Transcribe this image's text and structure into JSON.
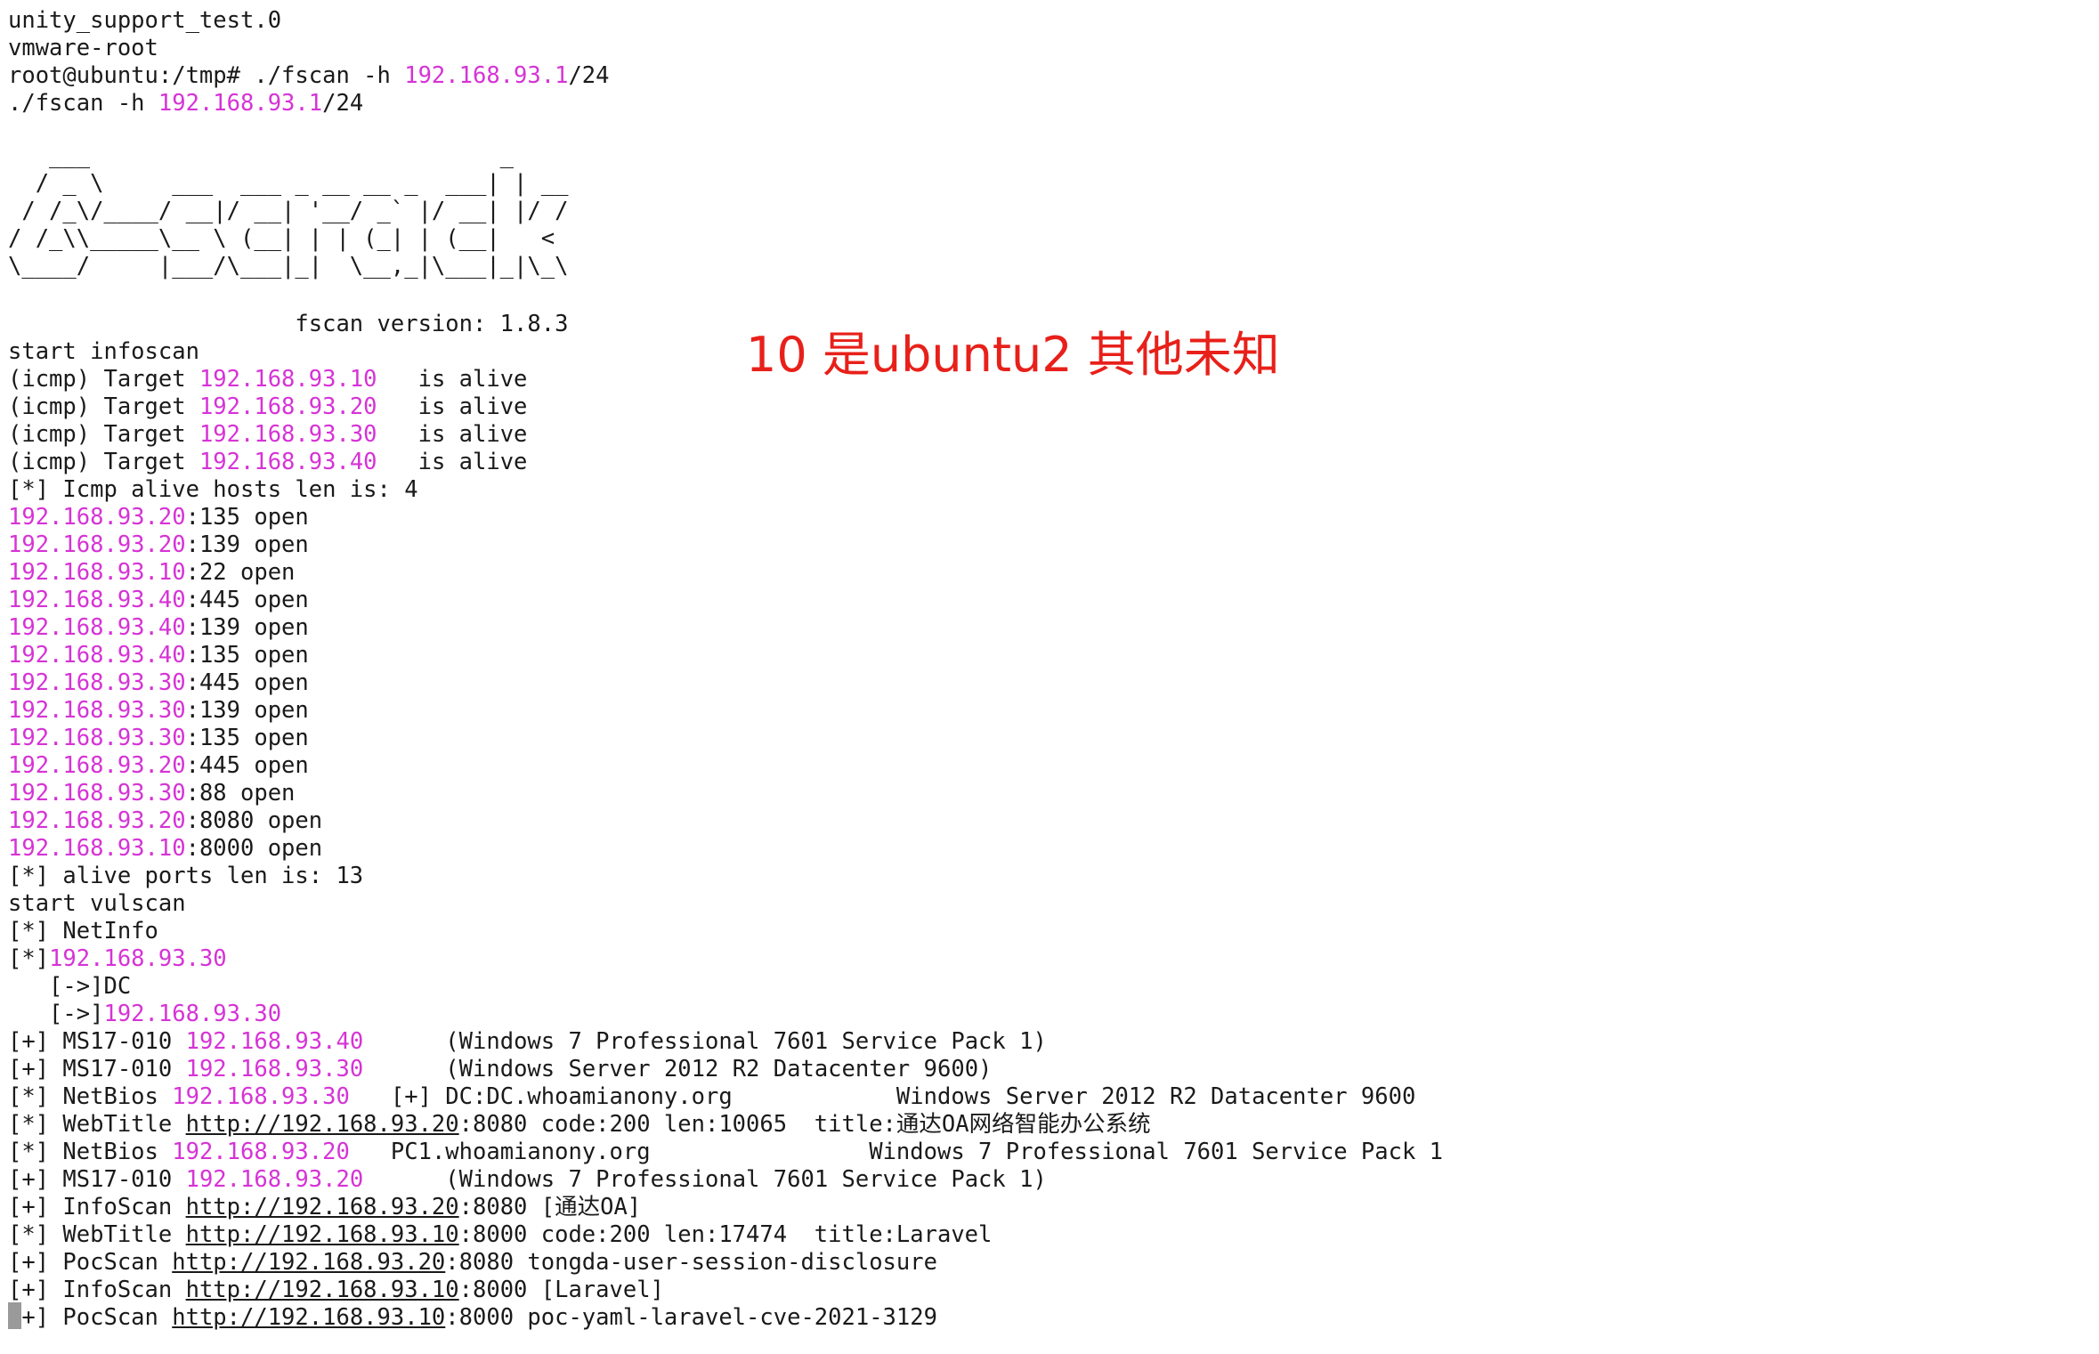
{
  "colors": {
    "background": "#ffffff",
    "text": "#1a1a1a",
    "ip": "#d633d6",
    "annotation": "#e8201a"
  },
  "banner": {
    "art": "   ___                              _    \n  / _ \\     ___  ___ _ __ __ _  ___| | __ \n / /_\\/____/ __|/ __| '__/ _` |/ __| |/ /\n/ /_\\\\_____\\__ \\ (__| | | (_| | (__|   <\n\\____/     |___/\\___|_|  \\__,_|\\___|_|\\_\\",
    "version_line": "                     fscan version: 1.8.3"
  },
  "annotation": "10 是ubuntu2 其他未知",
  "pre_lines": [
    [
      {
        "t": "unity_support_test.0"
      }
    ],
    [
      {
        "t": "vmware-root"
      }
    ],
    [
      {
        "t": "root@ubuntu:/tmp# ./fscan -h "
      },
      {
        "t": "192.168.93.1",
        "c": "ip"
      },
      {
        "t": "/24"
      }
    ],
    [
      {
        "t": "./fscan -h "
      },
      {
        "t": "192.168.93.1",
        "c": "ip"
      },
      {
        "t": "/24"
      }
    ]
  ],
  "post_lines": [
    [
      {
        "t": "start infoscan"
      }
    ],
    [
      {
        "t": "(icmp) Target "
      },
      {
        "t": "192.168.93.10",
        "c": "ip"
      },
      {
        "t": "   is alive"
      }
    ],
    [
      {
        "t": "(icmp) Target "
      },
      {
        "t": "192.168.93.20",
        "c": "ip"
      },
      {
        "t": "   is alive"
      }
    ],
    [
      {
        "t": "(icmp) Target "
      },
      {
        "t": "192.168.93.30",
        "c": "ip"
      },
      {
        "t": "   is alive"
      }
    ],
    [
      {
        "t": "(icmp) Target "
      },
      {
        "t": "192.168.93.40",
        "c": "ip"
      },
      {
        "t": "   is alive"
      }
    ],
    [
      {
        "t": "[*] Icmp alive hosts len is: 4"
      }
    ],
    [
      {
        "t": "192.168.93.20",
        "c": "ip"
      },
      {
        "t": ":135 open"
      }
    ],
    [
      {
        "t": "192.168.93.20",
        "c": "ip"
      },
      {
        "t": ":139 open"
      }
    ],
    [
      {
        "t": "192.168.93.10",
        "c": "ip"
      },
      {
        "t": ":22 open"
      }
    ],
    [
      {
        "t": "192.168.93.40",
        "c": "ip"
      },
      {
        "t": ":445 open"
      }
    ],
    [
      {
        "t": "192.168.93.40",
        "c": "ip"
      },
      {
        "t": ":139 open"
      }
    ],
    [
      {
        "t": "192.168.93.40",
        "c": "ip"
      },
      {
        "t": ":135 open"
      }
    ],
    [
      {
        "t": "192.168.93.30",
        "c": "ip"
      },
      {
        "t": ":445 open"
      }
    ],
    [
      {
        "t": "192.168.93.30",
        "c": "ip"
      },
      {
        "t": ":139 open"
      }
    ],
    [
      {
        "t": "192.168.93.30",
        "c": "ip"
      },
      {
        "t": ":135 open"
      }
    ],
    [
      {
        "t": "192.168.93.20",
        "c": "ip"
      },
      {
        "t": ":445 open"
      }
    ],
    [
      {
        "t": "192.168.93.30",
        "c": "ip"
      },
      {
        "t": ":88 open"
      }
    ],
    [
      {
        "t": "192.168.93.20",
        "c": "ip"
      },
      {
        "t": ":8080 open"
      }
    ],
    [
      {
        "t": "192.168.93.10",
        "c": "ip"
      },
      {
        "t": ":8000 open"
      }
    ],
    [
      {
        "t": "[*] alive ports len is: 13"
      }
    ],
    [
      {
        "t": "start vulscan"
      }
    ],
    [
      {
        "t": "[*] NetInfo"
      }
    ],
    [
      {
        "t": "[*]"
      },
      {
        "t": "192.168.93.30",
        "c": "ip"
      }
    ],
    [
      {
        "t": "   [->]DC"
      }
    ],
    [
      {
        "t": "   [->]"
      },
      {
        "t": "192.168.93.30",
        "c": "ip"
      }
    ],
    [
      {
        "t": "[+] MS17-010 "
      },
      {
        "t": "192.168.93.40",
        "c": "ip"
      },
      {
        "t": "      (Windows 7 Professional 7601 Service Pack 1)"
      }
    ],
    [
      {
        "t": "[+] MS17-010 "
      },
      {
        "t": "192.168.93.30",
        "c": "ip"
      },
      {
        "t": "      (Windows Server 2012 R2 Datacenter 9600)"
      }
    ],
    [
      {
        "t": "[*] NetBios "
      },
      {
        "t": "192.168.93.30",
        "c": "ip"
      },
      {
        "t": "   [+] DC:DC.whoamianony.org            Windows Server 2012 R2 Datacenter 9600"
      }
    ],
    [
      {
        "t": "[*] WebTitle "
      },
      {
        "t": "http://192.168.93.20",
        "c": "url"
      },
      {
        "t": ":8080 code:200 len:10065  title:通达OA网络智能办公系统"
      }
    ],
    [
      {
        "t": "[*] NetBios "
      },
      {
        "t": "192.168.93.20",
        "c": "ip"
      },
      {
        "t": "   PC1.whoamianony.org                Windows 7 Professional 7601 Service Pack 1"
      }
    ],
    [
      {
        "t": "[+] MS17-010 "
      },
      {
        "t": "192.168.93.20",
        "c": "ip"
      },
      {
        "t": "      (Windows 7 Professional 7601 Service Pack 1)"
      }
    ],
    [
      {
        "t": "[+] InfoScan "
      },
      {
        "t": "http://192.168.93.20",
        "c": "url"
      },
      {
        "t": ":8080 [通达OA]"
      }
    ],
    [
      {
        "t": "[*] WebTitle "
      },
      {
        "t": "http://192.168.93.10",
        "c": "url"
      },
      {
        "t": ":8000 code:200 len:17474  title:Laravel"
      }
    ],
    [
      {
        "t": "[+] PocScan "
      },
      {
        "t": "http://192.168.93.20",
        "c": "url"
      },
      {
        "t": ":8080 tongda-user-session-disclosure"
      }
    ],
    [
      {
        "t": "[+] InfoScan "
      },
      {
        "t": "http://192.168.93.10",
        "c": "url"
      },
      {
        "t": ":8000 [Laravel]"
      }
    ],
    [
      {
        "t": "[+] PocScan "
      },
      {
        "t": "http://192.168.93.10",
        "c": "url"
      },
      {
        "t": ":8000 poc-yaml-laravel-cve-2021-3129"
      }
    ]
  ]
}
